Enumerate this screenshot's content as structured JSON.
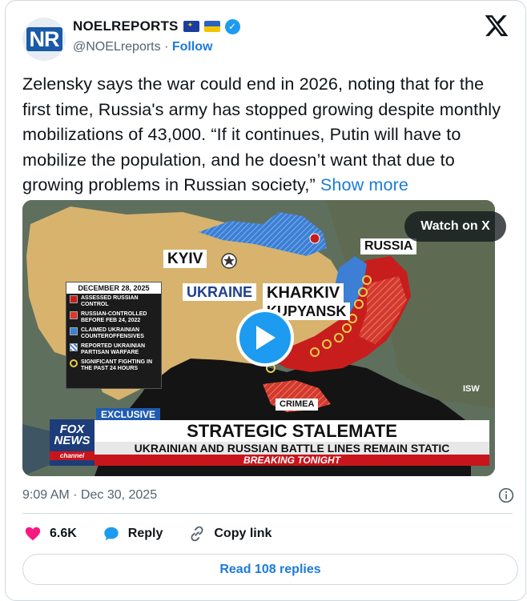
{
  "author": {
    "display_name": "NOELREPORTS",
    "handle": "@NOELreports",
    "separator": "·",
    "follow_label": "Follow",
    "avatar_text": "NR",
    "badges": [
      "eu-flag-icon",
      "ukraine-flag-icon",
      "verified-badge-icon"
    ]
  },
  "tweet": {
    "text": "Zelensky says the war could end in 2026, noting that for the first time, Russia's army has stopped growing despite monthly mobilizations of 43,000. “If it continues, Putin will have to mobilize the population, and he doesn’t want that due to growing problems in Russian society,”",
    "show_more_label": "Show more"
  },
  "media": {
    "watch_label": "Watch on X",
    "labels": {
      "kyiv": "KYIV",
      "russia": "RUSSIA",
      "ukraine": "UKRAINE",
      "kharkiv": "KHARKIV",
      "kupyansk": "KUPYANSK",
      "crimea": "CRIMEA",
      "isw": "ISW"
    },
    "legend": {
      "title": "DECEMBER 28, 2025",
      "items": [
        {
          "label": "ASSESSED RUSSIAN CONTROL",
          "color": "#c81d1d"
        },
        {
          "label": "RUSSIAN-CONTROLLED BEFORE FEB 24, 2022",
          "color": "#e0352b"
        },
        {
          "label": "CLAIMED UKRAINIAN COUNTEROFFENSIVES",
          "color": "#3c7fd4"
        },
        {
          "label": "REPORTED UKRAINIAN PARTISAN WARFARE",
          "color": "#ffffff"
        },
        {
          "label": "SIGNIFICANT FIGHTING IN THE PAST 24 HOURS",
          "color": "#e6d04a"
        }
      ]
    },
    "chyron": {
      "exclusive": "EXCLUSIVE",
      "headline": "STRATEGIC STALEMATE",
      "subheadline": "UKRAINIAN AND RUSSIAN BATTLE LINES REMAIN STATIC",
      "breaking": "BREAKING TONIGHT"
    },
    "network": {
      "line1": "FOX",
      "line2": "NEWS",
      "line3": "channel"
    }
  },
  "meta": {
    "timestamp": "9:09 AM · Dec 30, 2025"
  },
  "actions": {
    "likes_count": "6.6K",
    "reply_label": "Reply",
    "copy_link_label": "Copy link",
    "read_replies_label": "Read 108 replies"
  },
  "colors": {
    "accent": "#1d9bf0",
    "link": "#1d7bd7",
    "like": "#f91880",
    "muted": "#536471"
  }
}
